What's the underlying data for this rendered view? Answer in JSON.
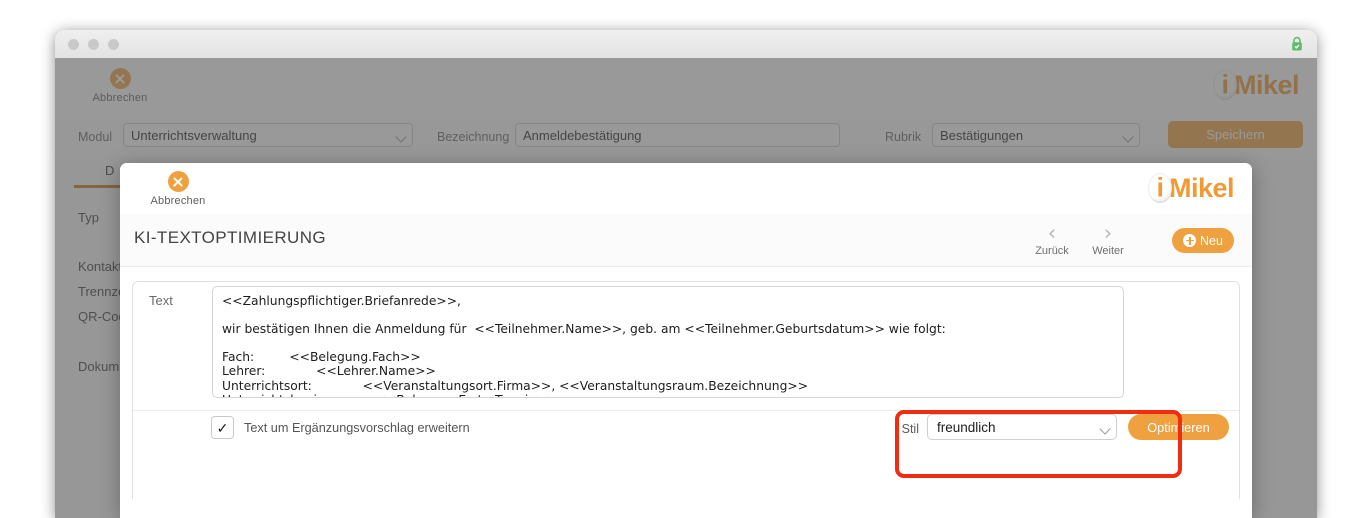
{
  "background_window": {
    "titlebar": {
      "traffic_lights": [
        "close",
        "minimize",
        "maximize"
      ],
      "lock_icon": "lock-icon"
    },
    "toolbar": {
      "cancel_label": "Abbrechen",
      "logo_text": "Mikel"
    },
    "form": {
      "modul_label": "Modul",
      "modul_value": "Unterrichtsverwaltung",
      "bezeichnung_label": "Bezeichnung",
      "bezeichnung_value": "Anmeldebestätigung",
      "rubrik_label": "Rubrik",
      "rubrik_value": "Bestätigungen",
      "save_label": "Speichern"
    },
    "tabs": [
      {
        "label": "D"
      }
    ],
    "sidebar_labels": [
      "Typ",
      "Kontakt",
      "Trennze",
      "QR-Cod",
      "Dokum"
    ]
  },
  "modal": {
    "toolbar": {
      "cancel_label": "Abbrechen",
      "logo_text": "Mikel"
    },
    "header": {
      "title": "KI-TEXTOPTIMIERUNG",
      "back_label": "Zurück",
      "next_label": "Weiter",
      "new_label": "Neu"
    },
    "panel": {
      "text_label": "Text",
      "text_value": "<<Zahlungspflichtiger.Briefanrede>>,\n\nwir bestätigen Ihnen die Anmeldung für  <<Teilnehmer.Name>>, geb. am <<Teilnehmer.Geburtsdatum>> wie folgt:\n\nFach:         <<Belegung.Fach>>\nLehrer:             <<Lehrer.Name>>\nUnterrichtsort:             <<Veranstaltungsort.Firma>>, <<Veranstaltungsraum.Bezeichnung>>\nUnterrichtsbeginn:          <<Belegung.ErsterTermin>>\nTermin:            <<Belegung.Tag>>",
      "checkbox_checked": "✓",
      "checkbox_label": "Text um Ergänzungsvorschlag erweitern",
      "stil_label": "Stil",
      "stil_value": "freundlich",
      "optimize_label": "Optimieren"
    }
  },
  "colors": {
    "accent_orange": "#efa13f",
    "logo_orange": "#ef9a33",
    "annotation_red": "#f02c12",
    "tab_underline": "#c07c12",
    "lock_green": "#63ba6d"
  }
}
